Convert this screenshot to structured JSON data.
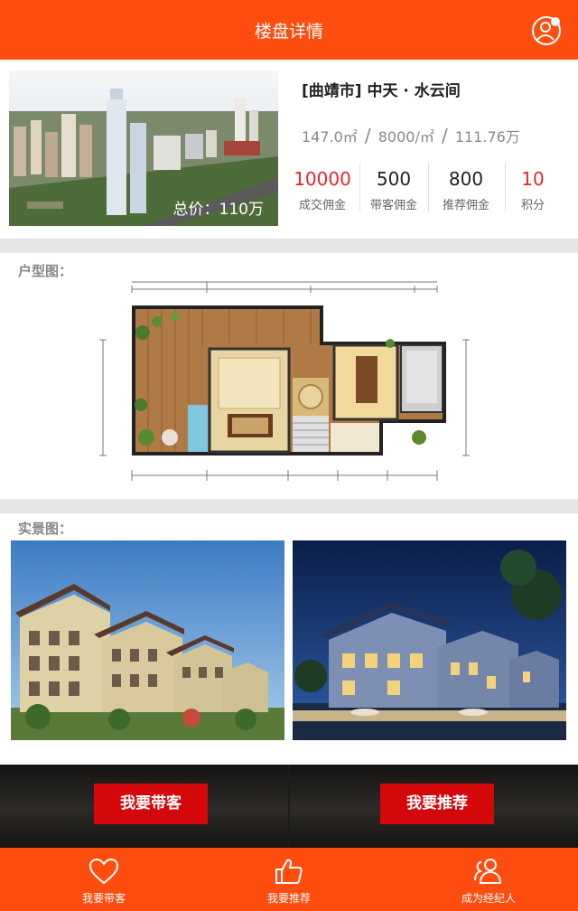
{
  "header": {
    "title": "楼盘详情"
  },
  "property": {
    "name": "[曲靖市] 中天 · 水云间",
    "total_price": "总价：110万",
    "area": "147.0㎡",
    "unit_price": "8000/㎡",
    "extra": "111.76万",
    "separator": "/"
  },
  "stats": [
    {
      "value": "10000",
      "label": "成交佣金",
      "color": "#e8262b"
    },
    {
      "value": "500",
      "label": "带客佣金",
      "color": "#222222"
    },
    {
      "value": "800",
      "label": "推荐佣金",
      "color": "#222222"
    },
    {
      "value": "10",
      "label": "积分",
      "color": "#e8262b"
    }
  ],
  "sections": {
    "floorplan_title": "户型图：",
    "photos_title": "实景图："
  },
  "cta": {
    "bring_client": "我要带客",
    "recommend": "我要推荐"
  },
  "tabbar": [
    {
      "label": "我要带客",
      "icon": "heart-icon"
    },
    {
      "label": "我要推荐",
      "icon": "thumbs-up-icon"
    },
    {
      "label": "成为经纪人",
      "icon": "users-icon"
    }
  ],
  "colors": {
    "brand": "#ff4d10",
    "cta": "#d4080a",
    "accent_red": "#e8262b"
  }
}
